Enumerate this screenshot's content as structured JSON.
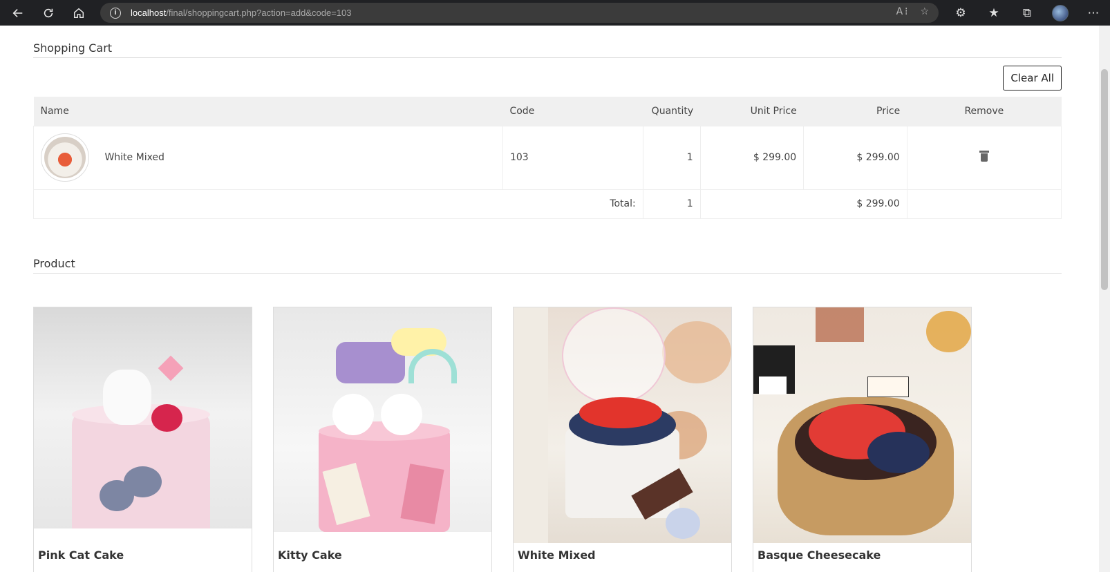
{
  "browser": {
    "url_host": "localhost",
    "url_path": "/final/shoppingcart.php?action=add&code=103"
  },
  "cart": {
    "title": "Shopping Cart",
    "clear_label": "Clear All",
    "headers": {
      "name": "Name",
      "code": "Code",
      "quantity": "Quantity",
      "unit_price": "Unit Price",
      "price": "Price",
      "remove": "Remove"
    },
    "items": [
      {
        "name": "White Mixed",
        "code": "103",
        "quantity": "1",
        "unit_price": "$ 299.00",
        "price": "$ 299.00"
      }
    ],
    "total_label": "Total:",
    "total_quantity": "1",
    "total_price": "$ 299.00"
  },
  "products": {
    "title": "Product",
    "items": [
      {
        "name": "Pink Cat Cake"
      },
      {
        "name": "Kitty Cake"
      },
      {
        "name": "White Mixed"
      },
      {
        "name": "Basque Cheesecake"
      }
    ]
  },
  "icons": {
    "back": "back-arrow-icon",
    "refresh": "refresh-icon",
    "home": "home-icon",
    "info": "info-icon",
    "trash": "trash-icon"
  }
}
